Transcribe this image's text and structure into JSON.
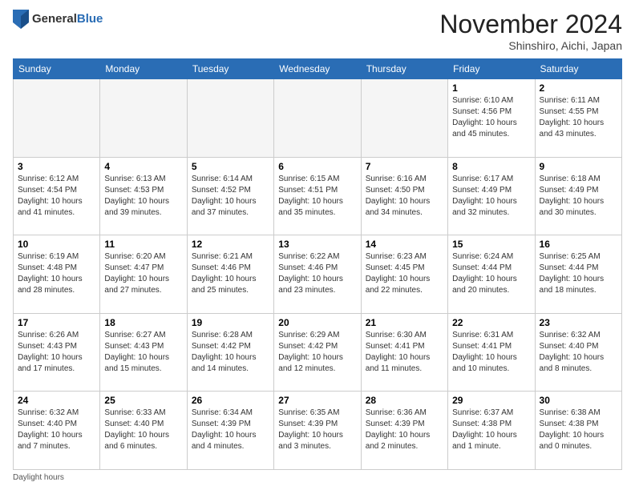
{
  "logo": {
    "general": "General",
    "blue": "Blue"
  },
  "header": {
    "month": "November 2024",
    "location": "Shinshiro, Aichi, Japan"
  },
  "days_of_week": [
    "Sunday",
    "Monday",
    "Tuesday",
    "Wednesday",
    "Thursday",
    "Friday",
    "Saturday"
  ],
  "footer": {
    "daylight_hours": "Daylight hours"
  },
  "weeks": [
    [
      {
        "day": "",
        "info": ""
      },
      {
        "day": "",
        "info": ""
      },
      {
        "day": "",
        "info": ""
      },
      {
        "day": "",
        "info": ""
      },
      {
        "day": "",
        "info": ""
      },
      {
        "day": "1",
        "info": "Sunrise: 6:10 AM\nSunset: 4:56 PM\nDaylight: 10 hours\nand 45 minutes."
      },
      {
        "day": "2",
        "info": "Sunrise: 6:11 AM\nSunset: 4:55 PM\nDaylight: 10 hours\nand 43 minutes."
      }
    ],
    [
      {
        "day": "3",
        "info": "Sunrise: 6:12 AM\nSunset: 4:54 PM\nDaylight: 10 hours\nand 41 minutes."
      },
      {
        "day": "4",
        "info": "Sunrise: 6:13 AM\nSunset: 4:53 PM\nDaylight: 10 hours\nand 39 minutes."
      },
      {
        "day": "5",
        "info": "Sunrise: 6:14 AM\nSunset: 4:52 PM\nDaylight: 10 hours\nand 37 minutes."
      },
      {
        "day": "6",
        "info": "Sunrise: 6:15 AM\nSunset: 4:51 PM\nDaylight: 10 hours\nand 35 minutes."
      },
      {
        "day": "7",
        "info": "Sunrise: 6:16 AM\nSunset: 4:50 PM\nDaylight: 10 hours\nand 34 minutes."
      },
      {
        "day": "8",
        "info": "Sunrise: 6:17 AM\nSunset: 4:49 PM\nDaylight: 10 hours\nand 32 minutes."
      },
      {
        "day": "9",
        "info": "Sunrise: 6:18 AM\nSunset: 4:49 PM\nDaylight: 10 hours\nand 30 minutes."
      }
    ],
    [
      {
        "day": "10",
        "info": "Sunrise: 6:19 AM\nSunset: 4:48 PM\nDaylight: 10 hours\nand 28 minutes."
      },
      {
        "day": "11",
        "info": "Sunrise: 6:20 AM\nSunset: 4:47 PM\nDaylight: 10 hours\nand 27 minutes."
      },
      {
        "day": "12",
        "info": "Sunrise: 6:21 AM\nSunset: 4:46 PM\nDaylight: 10 hours\nand 25 minutes."
      },
      {
        "day": "13",
        "info": "Sunrise: 6:22 AM\nSunset: 4:46 PM\nDaylight: 10 hours\nand 23 minutes."
      },
      {
        "day": "14",
        "info": "Sunrise: 6:23 AM\nSunset: 4:45 PM\nDaylight: 10 hours\nand 22 minutes."
      },
      {
        "day": "15",
        "info": "Sunrise: 6:24 AM\nSunset: 4:44 PM\nDaylight: 10 hours\nand 20 minutes."
      },
      {
        "day": "16",
        "info": "Sunrise: 6:25 AM\nSunset: 4:44 PM\nDaylight: 10 hours\nand 18 minutes."
      }
    ],
    [
      {
        "day": "17",
        "info": "Sunrise: 6:26 AM\nSunset: 4:43 PM\nDaylight: 10 hours\nand 17 minutes."
      },
      {
        "day": "18",
        "info": "Sunrise: 6:27 AM\nSunset: 4:43 PM\nDaylight: 10 hours\nand 15 minutes."
      },
      {
        "day": "19",
        "info": "Sunrise: 6:28 AM\nSunset: 4:42 PM\nDaylight: 10 hours\nand 14 minutes."
      },
      {
        "day": "20",
        "info": "Sunrise: 6:29 AM\nSunset: 4:42 PM\nDaylight: 10 hours\nand 12 minutes."
      },
      {
        "day": "21",
        "info": "Sunrise: 6:30 AM\nSunset: 4:41 PM\nDaylight: 10 hours\nand 11 minutes."
      },
      {
        "day": "22",
        "info": "Sunrise: 6:31 AM\nSunset: 4:41 PM\nDaylight: 10 hours\nand 10 minutes."
      },
      {
        "day": "23",
        "info": "Sunrise: 6:32 AM\nSunset: 4:40 PM\nDaylight: 10 hours\nand 8 minutes."
      }
    ],
    [
      {
        "day": "24",
        "info": "Sunrise: 6:32 AM\nSunset: 4:40 PM\nDaylight: 10 hours\nand 7 minutes."
      },
      {
        "day": "25",
        "info": "Sunrise: 6:33 AM\nSunset: 4:40 PM\nDaylight: 10 hours\nand 6 minutes."
      },
      {
        "day": "26",
        "info": "Sunrise: 6:34 AM\nSunset: 4:39 PM\nDaylight: 10 hours\nand 4 minutes."
      },
      {
        "day": "27",
        "info": "Sunrise: 6:35 AM\nSunset: 4:39 PM\nDaylight: 10 hours\nand 3 minutes."
      },
      {
        "day": "28",
        "info": "Sunrise: 6:36 AM\nSunset: 4:39 PM\nDaylight: 10 hours\nand 2 minutes."
      },
      {
        "day": "29",
        "info": "Sunrise: 6:37 AM\nSunset: 4:38 PM\nDaylight: 10 hours\nand 1 minute."
      },
      {
        "day": "30",
        "info": "Sunrise: 6:38 AM\nSunset: 4:38 PM\nDaylight: 10 hours\nand 0 minutes."
      }
    ]
  ]
}
